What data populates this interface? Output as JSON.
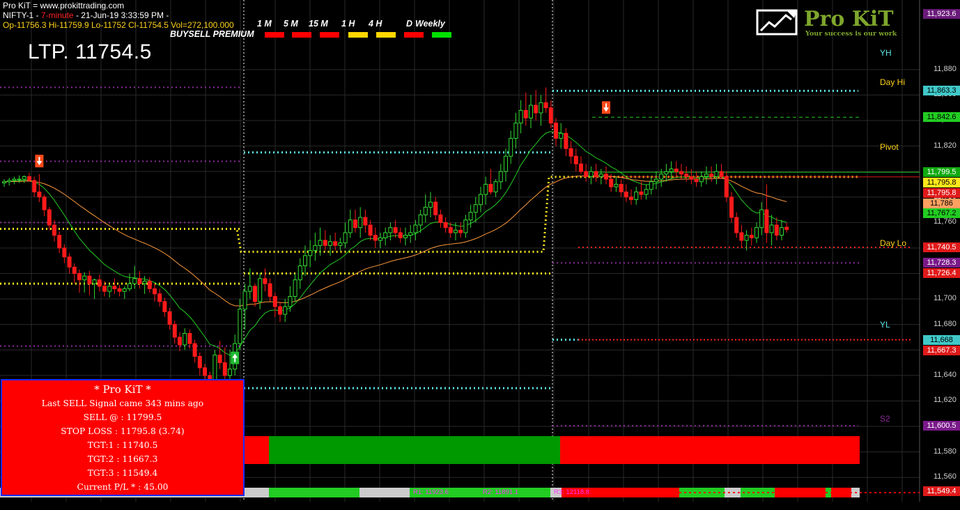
{
  "header": {
    "line1": "Pro KiT = www.prokittrading.com",
    "symbol": "NIFTY-1 -",
    "timeframe": "7-minute",
    "datetime": "- 21-Jun-19 3:33:59 PM -",
    "ohlc": "Op-11756.3  Hi-11759.9  Lo-11752  Cl-11754.5  Vol=272,100.000"
  },
  "ltp_label": "LTP. 11754.5",
  "buysell_label": "BUYSELL PREMIUM",
  "timeframes": [
    {
      "label": "1 M",
      "status": "sell",
      "color": "#ff0000"
    },
    {
      "label": "5 M",
      "status": "sell",
      "color": "#ff0000"
    },
    {
      "label": "15 M",
      "status": "sell",
      "color": "#ff0000"
    },
    {
      "label": "1 H",
      "status": "neutral",
      "color": "#ffd700"
    },
    {
      "label": "4 H",
      "status": "neutral",
      "color": "#ffd700"
    },
    {
      "label": "D",
      "status": "sell",
      "color": "#ff0000"
    },
    {
      "label": "Weekly",
      "status": "buy",
      "color": "#00e000"
    }
  ],
  "logo": {
    "name": "Pro KiT",
    "tagline": "Your success is our work",
    "icon": "chart-monitor-icon"
  },
  "pivot_tags": {
    "yh": "YH",
    "dayhi": "Day Hi",
    "pivot": "Pivot",
    "daylo": "Day Lo",
    "yl": "YL",
    "s2": "S2"
  },
  "info_box": {
    "title": "* Pro KiT  *",
    "lines": [
      "Last SELL Signal came 343 mins ago",
      "SELL @ : 11799.5",
      "STOP LOSS : 11795.8 (3.74)",
      "TGT:1 : 11740.5",
      "TGT:2 : 11667.3",
      "TGT:3 : 11549.4",
      "Current P/L * : 45.00"
    ]
  },
  "pivot_levels_bar": {
    "r1": "R1: 11923.6",
    "r2": "R2: 11891.1",
    "r3": "R3: 12118.8"
  },
  "colors": {
    "bull": "#33dd33",
    "bear": "#ff1a1a",
    "bg": "#000000",
    "grid": "#2a2a2a",
    "ema_fast": "#22cc22",
    "ema_slow": "#ff9a3c"
  },
  "chart_data": {
    "type": "candlestick",
    "symbol": "NIFTY-1",
    "interval": "7-minute",
    "ylim": [
      11541,
      11928
    ],
    "y_ticks": [
      11560,
      11580,
      11600,
      11620,
      11640,
      11660,
      11680,
      11700,
      11720,
      11740,
      11760,
      11780,
      11800,
      11820,
      11840,
      11860,
      11880
    ],
    "y_tick_labels": [
      "11,560",
      "11,580",
      "11,600",
      "11,620",
      "11,640",
      "11,660",
      "11,680",
      "11,700",
      "11,720",
      "11,740",
      "11,760",
      "11,780",
      "11,800",
      "11,820",
      "11,840",
      "11,860",
      "11,880"
    ],
    "price_badges": [
      {
        "label": "11,923.6",
        "value": 11923.6,
        "bg": "#6a1a7a",
        "fg": "#ffffff"
      },
      {
        "label": "11,863.3",
        "value": 11863.3,
        "bg": "#40c8c8",
        "fg": "#000000"
      },
      {
        "label": "11,842.6",
        "value": 11842.6,
        "bg": "#22cc22",
        "fg": "#000000"
      },
      {
        "label": "11,799.5",
        "value": 11799.5,
        "bg": "#11aa11",
        "fg": "#ffffff"
      },
      {
        "label": "11,795.8",
        "value": 11795.8,
        "bg": "#ffe81a",
        "fg": "#000000"
      },
      {
        "label": "11,795.8",
        "value": 11795.8,
        "bg": "#e01a1a",
        "fg": "#ffffff"
      },
      {
        "label": "11,786",
        "value": 11786.0,
        "bg": "#ffa060",
        "fg": "#000000"
      },
      {
        "label": "11,767.2",
        "value": 11767.2,
        "bg": "#22cc22",
        "fg": "#000000"
      },
      {
        "label": "11,740.5",
        "value": 11740.5,
        "bg": "#e01a1a",
        "fg": "#ffffff"
      },
      {
        "label": "11,728.3",
        "value": 11728.3,
        "bg": "#7a1a8a",
        "fg": "#ffffff"
      },
      {
        "label": "11,726.4",
        "value": 11726.4,
        "bg": "#e01a1a",
        "fg": "#ffffff"
      },
      {
        "label": "11,668",
        "value": 11668.0,
        "bg": "#40c8c8",
        "fg": "#000000"
      },
      {
        "label": "11,667.3",
        "value": 11667.3,
        "bg": "#e01a1a",
        "fg": "#ffffff"
      },
      {
        "label": "11,600.5",
        "value": 11600.5,
        "bg": "#7a1a8a",
        "fg": "#ffffff"
      },
      {
        "label": "11,549.4",
        "value": 11549.4,
        "bg": "#e01a1a",
        "fg": "#ffffff"
      }
    ],
    "levels": {
      "yh": 11863.3,
      "day_hi": 11842.6,
      "pivot": 11795.8,
      "target1": 11740.5,
      "day_lo": 11728.3,
      "yl": 11668.0,
      "s2": 11600.5,
      "target3": 11549.4
    },
    "signals": [
      {
        "type": "sell",
        "bar": 7,
        "price": 11800
      },
      {
        "type": "buy",
        "bar": 46,
        "price": 11662
      },
      {
        "type": "sell",
        "bar": 120,
        "price": 11842
      }
    ],
    "candles": [
      {
        "o": 11791,
        "h": 11794,
        "l": 11788,
        "c": 11792
      },
      {
        "o": 11792,
        "h": 11795,
        "l": 11789,
        "c": 11793
      },
      {
        "o": 11793,
        "h": 11796,
        "l": 11790,
        "c": 11794
      },
      {
        "o": 11794,
        "h": 11797,
        "l": 11791,
        "c": 11794
      },
      {
        "o": 11794,
        "h": 11797,
        "l": 11791,
        "c": 11796
      },
      {
        "o": 11796,
        "h": 11799,
        "l": 11792,
        "c": 11793
      },
      {
        "o": 11793,
        "h": 11796,
        "l": 11780,
        "c": 11784
      },
      {
        "o": 11784,
        "h": 11798,
        "l": 11776,
        "c": 11780
      },
      {
        "o": 11780,
        "h": 11782,
        "l": 11765,
        "c": 11770
      },
      {
        "o": 11770,
        "h": 11772,
        "l": 11754,
        "c": 11758
      },
      {
        "o": 11758,
        "h": 11762,
        "l": 11745,
        "c": 11750
      },
      {
        "o": 11750,
        "h": 11753,
        "l": 11736,
        "c": 11740
      },
      {
        "o": 11740,
        "h": 11743,
        "l": 11728,
        "c": 11733
      },
      {
        "o": 11733,
        "h": 11736,
        "l": 11720,
        "c": 11725
      },
      {
        "o": 11725,
        "h": 11728,
        "l": 11712,
        "c": 11720
      },
      {
        "o": 11720,
        "h": 11723,
        "l": 11705,
        "c": 11715
      },
      {
        "o": 11715,
        "h": 11721,
        "l": 11705,
        "c": 11718
      },
      {
        "o": 11718,
        "h": 11722,
        "l": 11703,
        "c": 11712
      },
      {
        "o": 11712,
        "h": 11716,
        "l": 11700,
        "c": 11715
      },
      {
        "o": 11715,
        "h": 11719,
        "l": 11706,
        "c": 11710
      },
      {
        "o": 11710,
        "h": 11714,
        "l": 11702,
        "c": 11706
      },
      {
        "o": 11706,
        "h": 11712,
        "l": 11701,
        "c": 11710
      },
      {
        "o": 11710,
        "h": 11716,
        "l": 11704,
        "c": 11708
      },
      {
        "o": 11708,
        "h": 11711,
        "l": 11702,
        "c": 11706
      },
      {
        "o": 11706,
        "h": 11710,
        "l": 11700,
        "c": 11708
      },
      {
        "o": 11708,
        "h": 11720,
        "l": 11706,
        "c": 11712
      },
      {
        "o": 11712,
        "h": 11726,
        "l": 11708,
        "c": 11716
      },
      {
        "o": 11716,
        "h": 11722,
        "l": 11708,
        "c": 11712
      },
      {
        "o": 11712,
        "h": 11718,
        "l": 11704,
        "c": 11714
      },
      {
        "o": 11714,
        "h": 11717,
        "l": 11705,
        "c": 11708
      },
      {
        "o": 11708,
        "h": 11712,
        "l": 11698,
        "c": 11704
      },
      {
        "o": 11704,
        "h": 11708,
        "l": 11694,
        "c": 11698
      },
      {
        "o": 11698,
        "h": 11701,
        "l": 11686,
        "c": 11690
      },
      {
        "o": 11690,
        "h": 11693,
        "l": 11676,
        "c": 11680
      },
      {
        "o": 11680,
        "h": 11683,
        "l": 11665,
        "c": 11670
      },
      {
        "o": 11670,
        "h": 11674,
        "l": 11659,
        "c": 11664
      },
      {
        "o": 11664,
        "h": 11677,
        "l": 11660,
        "c": 11673
      },
      {
        "o": 11673,
        "h": 11676,
        "l": 11661,
        "c": 11665
      },
      {
        "o": 11665,
        "h": 11668,
        "l": 11650,
        "c": 11655
      },
      {
        "o": 11655,
        "h": 11658,
        "l": 11640,
        "c": 11646
      },
      {
        "o": 11646,
        "h": 11649,
        "l": 11634,
        "c": 11640
      },
      {
        "o": 11640,
        "h": 11643,
        "l": 11625,
        "c": 11632
      },
      {
        "o": 11632,
        "h": 11660,
        "l": 11628,
        "c": 11656
      },
      {
        "o": 11656,
        "h": 11667,
        "l": 11645,
        "c": 11650
      },
      {
        "o": 11650,
        "h": 11662,
        "l": 11630,
        "c": 11640
      },
      {
        "o": 11640,
        "h": 11660,
        "l": 11630,
        "c": 11645
      },
      {
        "o": 11645,
        "h": 11672,
        "l": 11640,
        "c": 11665
      },
      {
        "o": 11665,
        "h": 11700,
        "l": 11660,
        "c": 11692
      },
      {
        "o": 11692,
        "h": 11712,
        "l": 11676,
        "c": 11706
      },
      {
        "o": 11706,
        "h": 11724,
        "l": 11700,
        "c": 11710
      },
      {
        "o": 11710,
        "h": 11712,
        "l": 11694,
        "c": 11698
      },
      {
        "o": 11698,
        "h": 11720,
        "l": 11692,
        "c": 11716
      },
      {
        "o": 11716,
        "h": 11724,
        "l": 11706,
        "c": 11712
      },
      {
        "o": 11712,
        "h": 11716,
        "l": 11698,
        "c": 11702
      },
      {
        "o": 11702,
        "h": 11705,
        "l": 11686,
        "c": 11694
      },
      {
        "o": 11694,
        "h": 11698,
        "l": 11682,
        "c": 11688
      },
      {
        "o": 11688,
        "h": 11700,
        "l": 11682,
        "c": 11694
      },
      {
        "o": 11694,
        "h": 11710,
        "l": 11690,
        "c": 11702
      },
      {
        "o": 11702,
        "h": 11720,
        "l": 11698,
        "c": 11715
      },
      {
        "o": 11715,
        "h": 11732,
        "l": 11708,
        "c": 11726
      },
      {
        "o": 11726,
        "h": 11742,
        "l": 11718,
        "c": 11734
      },
      {
        "o": 11734,
        "h": 11746,
        "l": 11725,
        "c": 11738
      },
      {
        "o": 11738,
        "h": 11752,
        "l": 11730,
        "c": 11742
      },
      {
        "o": 11742,
        "h": 11756,
        "l": 11734,
        "c": 11746
      },
      {
        "o": 11746,
        "h": 11754,
        "l": 11738,
        "c": 11742
      },
      {
        "o": 11742,
        "h": 11750,
        "l": 11734,
        "c": 11745
      },
      {
        "o": 11745,
        "h": 11752,
        "l": 11738,
        "c": 11742
      },
      {
        "o": 11742,
        "h": 11748,
        "l": 11738,
        "c": 11744
      },
      {
        "o": 11744,
        "h": 11760,
        "l": 11740,
        "c": 11752
      },
      {
        "o": 11752,
        "h": 11770,
        "l": 11748,
        "c": 11762
      },
      {
        "o": 11762,
        "h": 11770,
        "l": 11752,
        "c": 11756
      },
      {
        "o": 11756,
        "h": 11772,
        "l": 11748,
        "c": 11764
      },
      {
        "o": 11764,
        "h": 11770,
        "l": 11752,
        "c": 11758
      },
      {
        "o": 11758,
        "h": 11762,
        "l": 11746,
        "c": 11750
      },
      {
        "o": 11750,
        "h": 11756,
        "l": 11740,
        "c": 11746
      },
      {
        "o": 11746,
        "h": 11752,
        "l": 11740,
        "c": 11748
      },
      {
        "o": 11748,
        "h": 11756,
        "l": 11742,
        "c": 11752
      },
      {
        "o": 11752,
        "h": 11760,
        "l": 11746,
        "c": 11756
      },
      {
        "o": 11756,
        "h": 11762,
        "l": 11748,
        "c": 11752
      },
      {
        "o": 11752,
        "h": 11756,
        "l": 11744,
        "c": 11748
      },
      {
        "o": 11748,
        "h": 11756,
        "l": 11742,
        "c": 11750
      },
      {
        "o": 11750,
        "h": 11758,
        "l": 11744,
        "c": 11752
      },
      {
        "o": 11752,
        "h": 11762,
        "l": 11746,
        "c": 11758
      },
      {
        "o": 11758,
        "h": 11770,
        "l": 11752,
        "c": 11766
      },
      {
        "o": 11766,
        "h": 11782,
        "l": 11760,
        "c": 11772
      },
      {
        "o": 11772,
        "h": 11784,
        "l": 11764,
        "c": 11776
      },
      {
        "o": 11776,
        "h": 11780,
        "l": 11762,
        "c": 11766
      },
      {
        "o": 11766,
        "h": 11770,
        "l": 11756,
        "c": 11760
      },
      {
        "o": 11760,
        "h": 11764,
        "l": 11752,
        "c": 11756
      },
      {
        "o": 11756,
        "h": 11760,
        "l": 11748,
        "c": 11752
      },
      {
        "o": 11752,
        "h": 11760,
        "l": 11746,
        "c": 11754
      },
      {
        "o": 11754,
        "h": 11760,
        "l": 11748,
        "c": 11752
      },
      {
        "o": 11752,
        "h": 11766,
        "l": 11748,
        "c": 11762
      },
      {
        "o": 11762,
        "h": 11774,
        "l": 11756,
        "c": 11768
      },
      {
        "o": 11768,
        "h": 11780,
        "l": 11760,
        "c": 11774
      },
      {
        "o": 11774,
        "h": 11788,
        "l": 11768,
        "c": 11782
      },
      {
        "o": 11782,
        "h": 11796,
        "l": 11774,
        "c": 11790
      },
      {
        "o": 11790,
        "h": 11802,
        "l": 11782,
        "c": 11784
      },
      {
        "o": 11784,
        "h": 11794,
        "l": 11780,
        "c": 11792
      },
      {
        "o": 11792,
        "h": 11806,
        "l": 11786,
        "c": 11800
      },
      {
        "o": 11800,
        "h": 11818,
        "l": 11792,
        "c": 11812
      },
      {
        "o": 11812,
        "h": 11832,
        "l": 11806,
        "c": 11826
      },
      {
        "o": 11826,
        "h": 11846,
        "l": 11818,
        "c": 11838
      },
      {
        "o": 11838,
        "h": 11856,
        "l": 11830,
        "c": 11848
      },
      {
        "o": 11848,
        "h": 11862,
        "l": 11836,
        "c": 11842
      },
      {
        "o": 11842,
        "h": 11860,
        "l": 11834,
        "c": 11852
      },
      {
        "o": 11852,
        "h": 11864,
        "l": 11840,
        "c": 11846
      },
      {
        "o": 11846,
        "h": 11860,
        "l": 11836,
        "c": 11854
      },
      {
        "o": 11854,
        "h": 11866,
        "l": 11846,
        "c": 11850
      },
      {
        "o": 11850,
        "h": 11856,
        "l": 11834,
        "c": 11838
      },
      {
        "o": 11838,
        "h": 11842,
        "l": 11820,
        "c": 11826
      },
      {
        "o": 11826,
        "h": 11838,
        "l": 11818,
        "c": 11830
      },
      {
        "o": 11830,
        "h": 11834,
        "l": 11812,
        "c": 11818
      },
      {
        "o": 11818,
        "h": 11824,
        "l": 11806,
        "c": 11812
      },
      {
        "o": 11812,
        "h": 11818,
        "l": 11800,
        "c": 11806
      },
      {
        "o": 11806,
        "h": 11812,
        "l": 11798,
        "c": 11800
      },
      {
        "o": 11800,
        "h": 11806,
        "l": 11792,
        "c": 11796
      },
      {
        "o": 11796,
        "h": 11804,
        "l": 11790,
        "c": 11800
      },
      {
        "o": 11800,
        "h": 11806,
        "l": 11792,
        "c": 11796
      },
      {
        "o": 11796,
        "h": 11802,
        "l": 11790,
        "c": 11798
      },
      {
        "o": 11798,
        "h": 11804,
        "l": 11790,
        "c": 11794
      },
      {
        "o": 11794,
        "h": 11798,
        "l": 11784,
        "c": 11788
      },
      {
        "o": 11788,
        "h": 11796,
        "l": 11784,
        "c": 11790
      },
      {
        "o": 11790,
        "h": 11794,
        "l": 11780,
        "c": 11784
      },
      {
        "o": 11784,
        "h": 11790,
        "l": 11776,
        "c": 11780
      },
      {
        "o": 11780,
        "h": 11786,
        "l": 11774,
        "c": 11778
      },
      {
        "o": 11778,
        "h": 11788,
        "l": 11774,
        "c": 11784
      },
      {
        "o": 11784,
        "h": 11792,
        "l": 11778,
        "c": 11782
      },
      {
        "o": 11782,
        "h": 11790,
        "l": 11778,
        "c": 11786
      },
      {
        "o": 11786,
        "h": 11796,
        "l": 11782,
        "c": 11792
      },
      {
        "o": 11792,
        "h": 11800,
        "l": 11786,
        "c": 11794
      },
      {
        "o": 11794,
        "h": 11802,
        "l": 11788,
        "c": 11798
      },
      {
        "o": 11798,
        "h": 11806,
        "l": 11792,
        "c": 11800
      },
      {
        "o": 11800,
        "h": 11808,
        "l": 11794,
        "c": 11802
      },
      {
        "o": 11802,
        "h": 11808,
        "l": 11796,
        "c": 11800
      },
      {
        "o": 11800,
        "h": 11806,
        "l": 11794,
        "c": 11798
      },
      {
        "o": 11798,
        "h": 11804,
        "l": 11792,
        "c": 11796
      },
      {
        "o": 11796,
        "h": 11802,
        "l": 11790,
        "c": 11794
      },
      {
        "o": 11794,
        "h": 11800,
        "l": 11788,
        "c": 11792
      },
      {
        "o": 11792,
        "h": 11800,
        "l": 11788,
        "c": 11796
      },
      {
        "o": 11796,
        "h": 11804,
        "l": 11790,
        "c": 11798
      },
      {
        "o": 11798,
        "h": 11804,
        "l": 11792,
        "c": 11796
      },
      {
        "o": 11796,
        "h": 11806,
        "l": 11790,
        "c": 11800
      },
      {
        "o": 11800,
        "h": 11806,
        "l": 11794,
        "c": 11796
      },
      {
        "o": 11796,
        "h": 11800,
        "l": 11776,
        "c": 11780
      },
      {
        "o": 11780,
        "h": 11784,
        "l": 11760,
        "c": 11764
      },
      {
        "o": 11764,
        "h": 11768,
        "l": 11748,
        "c": 11752
      },
      {
        "o": 11752,
        "h": 11758,
        "l": 11740,
        "c": 11746
      },
      {
        "o": 11746,
        "h": 11754,
        "l": 11738,
        "c": 11750
      },
      {
        "o": 11750,
        "h": 11756,
        "l": 11742,
        "c": 11748
      },
      {
        "o": 11748,
        "h": 11760,
        "l": 11744,
        "c": 11756
      },
      {
        "o": 11756,
        "h": 11776,
        "l": 11750,
        "c": 11770
      },
      {
        "o": 11770,
        "h": 11790,
        "l": 11744,
        "c": 11752
      },
      {
        "o": 11752,
        "h": 11766,
        "l": 11742,
        "c": 11758
      },
      {
        "o": 11758,
        "h": 11764,
        "l": 11746,
        "c": 11750
      },
      {
        "o": 11750,
        "h": 11762,
        "l": 11746,
        "c": 11756
      },
      {
        "o": 11756.3,
        "h": 11759.9,
        "l": 11752,
        "c": 11754.5
      }
    ]
  }
}
